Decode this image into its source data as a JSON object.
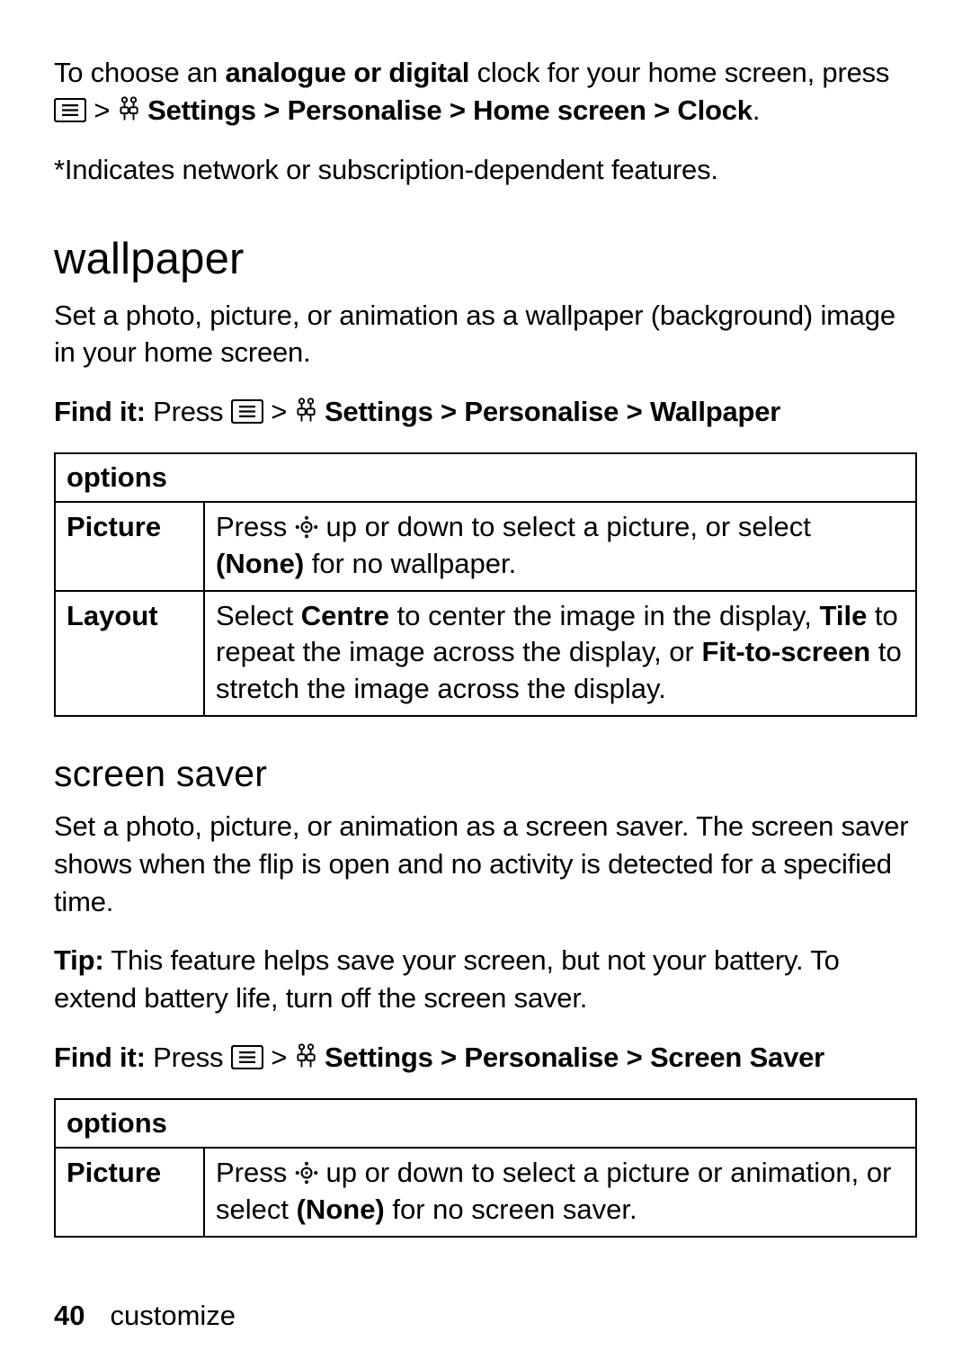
{
  "intro": {
    "pre": "To choose an ",
    "emph": "analogue or digital",
    "post1": " clock for your home screen, press ",
    "sep": " > ",
    "path": [
      "Settings",
      "Personalise",
      "Home screen",
      "Clock"
    ],
    "period": "."
  },
  "note": "*Indicates network or subscription-dependent features.",
  "wallpaper": {
    "heading": "wallpaper",
    "desc": "Set a photo, picture, or animation as a wallpaper (background) image in your home screen.",
    "findit_label": "Find it:",
    "findit_press": " Press ",
    "sep": " > ",
    "path": [
      "Settings",
      "Personalise",
      "Wallpaper"
    ],
    "table": {
      "header": "options",
      "rows": [
        {
          "label": "Picture",
          "pre": "Press ",
          "post1": " up or down to select a picture, or select ",
          "none": "(None)",
          "post2": " for no wallpaper."
        },
        {
          "label": "Layout",
          "pre": "Select ",
          "centre": "Centre",
          "t1": " to center the image in the display, ",
          "tile": "Tile",
          "t2": " to repeat the image across the display, or ",
          "fit": "Fit-to-screen",
          "t3": " to stretch the image across the display."
        }
      ]
    }
  },
  "screensaver": {
    "heading": "screen saver",
    "desc": "Set a photo, picture, or animation as a screen saver. The screen saver shows when the flip is open and no activity is detected for a specified time.",
    "tip_label": "Tip:",
    "tip_text": " This feature helps save your screen, but not your battery. To extend battery life, turn off the screen saver.",
    "findit_label": "Find it:",
    "findit_press": " Press ",
    "sep": " > ",
    "path": [
      "Settings",
      "Personalise",
      "Screen Saver"
    ],
    "table": {
      "header": "options",
      "rows": [
        {
          "label": "Picture",
          "pre": "Press ",
          "post1": " up or down to select a picture or animation, or select ",
          "none": "(None)",
          "post2": " for no screen saver."
        }
      ]
    }
  },
  "footer": {
    "page": "40",
    "section": "customize"
  }
}
